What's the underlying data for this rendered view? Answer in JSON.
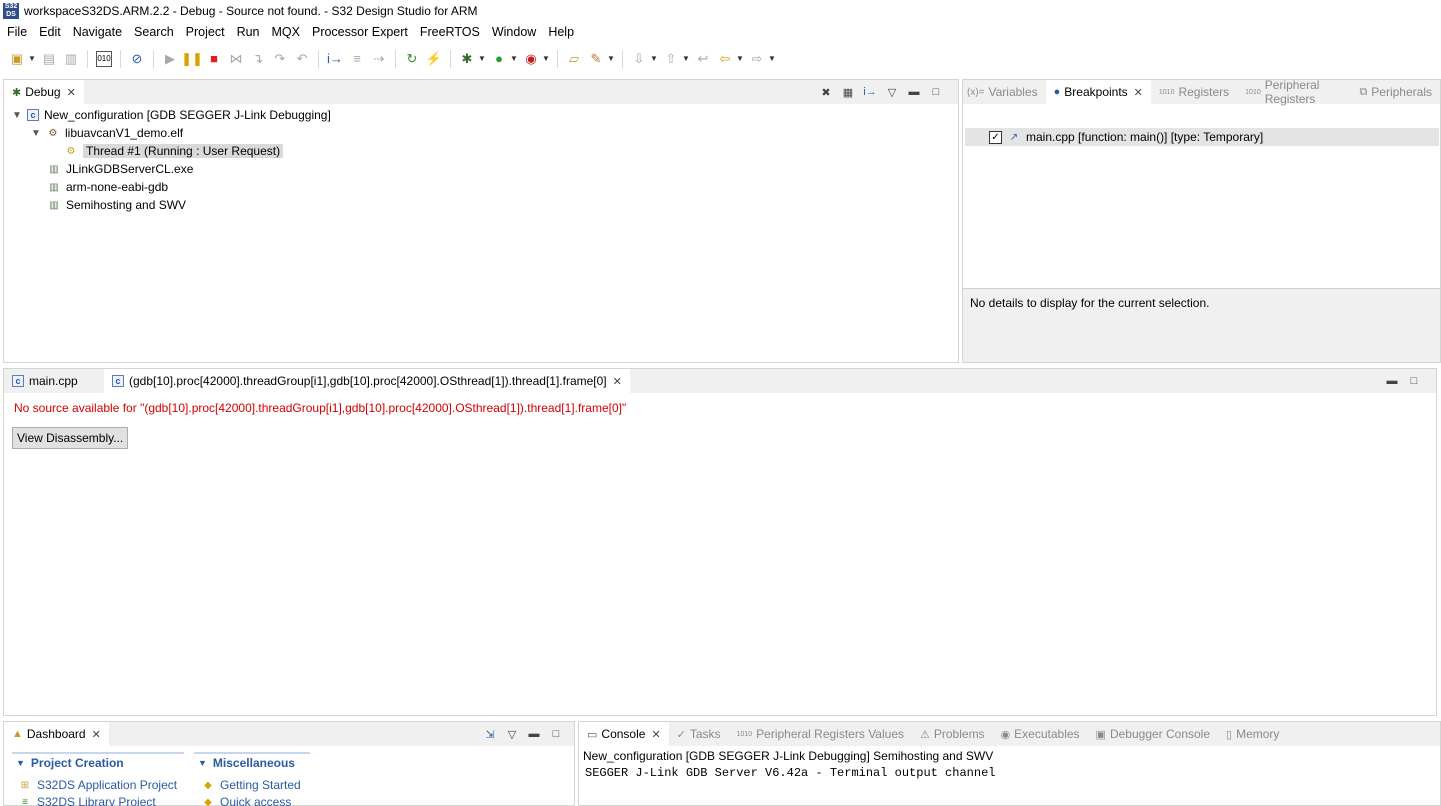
{
  "window": {
    "title": "workspaceS32DS.ARM.2.2 - Debug - Source not found. - S32 Design Studio for ARM",
    "app_icon_text": "S32DS"
  },
  "menubar": {
    "items": [
      "File",
      "Edit",
      "Navigate",
      "Search",
      "Project",
      "Run",
      "MQX",
      "Processor Expert",
      "FreeRTOS",
      "Window",
      "Help"
    ]
  },
  "toolbar": {
    "icons": [
      "new-icon",
      "save-icon",
      "save-all-icon",
      "binary-icon",
      "skip-breakpoints-icon",
      "resume-icon",
      "suspend-icon",
      "terminate-icon",
      "disconnect-icon",
      "step-into-icon",
      "step-over-icon",
      "step-return-icon",
      "instruction-stepping-icon",
      "restart-icon",
      "flash-icon",
      "debug-icon",
      "run-icon",
      "external-tools-icon",
      "open-folder-icon",
      "pin-icon",
      "next-annotation-icon",
      "prev-annotation-icon",
      "back-icon",
      "forward-icon"
    ]
  },
  "debug_view": {
    "tab_label": "Debug",
    "tree": [
      {
        "label": "New_configuration [GDB SEGGER J-Link Debugging]",
        "icon": "c-launch-icon"
      },
      {
        "label": "libuavcanV1_demo.elf",
        "icon": "process-icon"
      },
      {
        "label": "Thread #1 (Running : User Request)",
        "icon": "thread-icon"
      },
      {
        "label": "JLinkGDBServerCL.exe",
        "icon": "server-icon"
      },
      {
        "label": "arm-none-eabi-gdb",
        "icon": "server-icon"
      },
      {
        "label": "Semihosting and SWV",
        "icon": "server-icon"
      }
    ]
  },
  "right_view": {
    "tabs": [
      {
        "label": "Variables",
        "prefix": "(x)="
      },
      {
        "label": "Breakpoints"
      },
      {
        "label": "Registers",
        "prefix": "1010"
      },
      {
        "label": "Peripheral Registers",
        "prefix": "1010"
      },
      {
        "label": "Peripherals"
      }
    ],
    "breakpoint": {
      "label": "main.cpp [function: main()] [type: Temporary]",
      "checked": "✓"
    },
    "details": "No details to display for the current selection."
  },
  "editor": {
    "tabs": [
      {
        "label": "main.cpp"
      },
      {
        "label": "(gdb[10].proc[42000].threadGroup[i1],gdb[10].proc[42000].OSthread[1]).thread[1].frame[0]"
      }
    ],
    "message": "No source available for \"(gdb[10].proc[42000].threadGroup[i1],gdb[10].proc[42000].OSthread[1]).thread[1].frame[0]\"",
    "button": "View Disassembly..."
  },
  "dashboard": {
    "tab_label": "Dashboard",
    "groups": [
      {
        "title": "Project Creation",
        "links": [
          "S32DS Application Project",
          "S32DS Library Project"
        ]
      },
      {
        "title": "Miscellaneous",
        "links": [
          "Getting Started",
          "Quick access"
        ]
      }
    ]
  },
  "console": {
    "tabs": [
      "Console",
      "Tasks",
      "Peripheral Registers Values",
      "Problems",
      "Executables",
      "Debugger Console",
      "Memory"
    ],
    "header": "New_configuration [GDB SEGGER J-Link Debugging] Semihosting and SWV",
    "output": "SEGGER J-Link GDB Server V6.42a - Terminal output channel"
  }
}
